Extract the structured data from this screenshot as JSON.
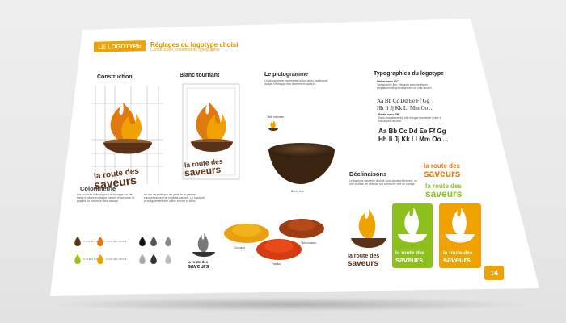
{
  "header": {
    "badge": "LE LOGOTYPE",
    "title": "Réglages du logotype choisi",
    "subtitle": "Construction, colorimétrie, typographie"
  },
  "sections": {
    "construction": "Construction",
    "blanc_tournant": "Blanc tournant",
    "pictogramme": "Le pictogramme",
    "typographies": "Typographies du logotype",
    "colorimetrie": "Colorimétrie",
    "declinaisons": "Déclinaisons"
  },
  "logo": {
    "line1": "la route des",
    "line2": "saveurs"
  },
  "pictogramme": {
    "text": "Le pictogramme représente un bol de riz traditionnel duquel s'échappe des flammes et saveurs.",
    "caption_small": "Taille minimum",
    "bowl_caption": "Bol en bois"
  },
  "typo": {
    "font1_name": "Walter sans ITC",
    "font1_text": "Typographie fine, élégante avec de légers empattements qui conservent un côté ancien.",
    "font1_sample1": "Aa Bb Cc Dd Ee Ff Gg",
    "font1_sample2": "Hh Ii Jj Kk Ll Mm Oo ...",
    "font2_name": "Berlin sans FB",
    "font2_text": "Sans empattements, elle évoque l'exotisme grâce à son aspect arrondi.",
    "font2_sample1": "Aa Bb Cc Dd Ee Ff Gg",
    "font2_sample2": "Hh Ii Jj Kk Ll Mm Oo ..."
  },
  "colorimetrie": {
    "text1": "Les couleurs utilisées pour le logotype ont été tirées d'épices exotiques comme le curcuma, le paprika ou encore le tikka masala.",
    "text2": "du vert rappelle que les plats de la gamme s'accompagnent de produits naturels. Le logotype peut également être utilisé en noir et blanc.",
    "swatches": [
      {
        "color": "#5a3218",
        "label": "C: 0 M: 85 J: 100 N: 60"
      },
      {
        "color": "#e07a10",
        "label": "C: 0 M: 60 J: 100 N: 0"
      },
      {
        "color": "#9cc21a",
        "label": "C: 40 M: 0 J: 100 N: 0"
      },
      {
        "color": "#f0a300",
        "label": "C: 0 M: 40 J: 100 N: 0"
      }
    ],
    "gray_swatches": [
      "#111111",
      "#555555",
      "#888888",
      "#aaaaaa",
      "#333333",
      "#bbbbbb"
    ]
  },
  "spices": {
    "curcuma": "Curcuma",
    "tikka": "Tikka masala",
    "paprika": "Paprika"
  },
  "declinaisons": {
    "text": "Le logotype peut être décliné sous plusieurs formes : en une couleur, en défonce sur cartouche vert ou orange."
  },
  "page": {
    "number": "14"
  },
  "colors": {
    "orange": "#f0a300",
    "brown": "#5a3218",
    "green": "#8dbf1f",
    "amber": "#e07a10"
  }
}
